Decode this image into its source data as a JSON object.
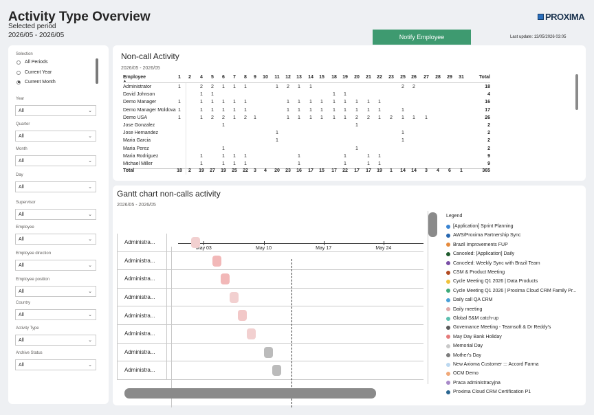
{
  "header": {
    "title": "Activity Type Overview",
    "subtitle": "Selected period",
    "range": "2026/05 - 2026/05",
    "notify_label": "Notify Employee",
    "last_update": "Last update: 13/05/2026 03:05",
    "logo_text": "PROXIMA"
  },
  "filters": {
    "selection_label": "Selection",
    "options": [
      "All Periods",
      "Current Year",
      "Current Month"
    ],
    "selected_option": "Current Month",
    "fields": [
      {
        "label": "Year",
        "value": "All"
      },
      {
        "label": "Quarter",
        "value": "All"
      },
      {
        "label": "Month",
        "value": "All"
      },
      {
        "label": "Day",
        "value": "All"
      },
      {
        "label": "Supervisor",
        "value": "All"
      },
      {
        "label": "Employee",
        "value": "All"
      },
      {
        "label": "Employee direction",
        "value": "All"
      },
      {
        "label": "Employee position",
        "value": "All"
      },
      {
        "label": "Country",
        "value": "All"
      },
      {
        "label": "Activity Type",
        "value": "All"
      },
      {
        "label": "Archive Status",
        "value": "All"
      }
    ]
  },
  "noncall": {
    "title": "Non-call Activity",
    "range": "2026/05 - 2026/05",
    "employee_header": "Employee",
    "total_header": "Total",
    "days": [
      "1",
      "2",
      "4",
      "5",
      "6",
      "7",
      "8",
      "9",
      "10",
      "11",
      "12",
      "13",
      "14",
      "15",
      "18",
      "19",
      "20",
      "21",
      "22",
      "23",
      "25",
      "26",
      "27",
      "28",
      "29",
      "31"
    ],
    "rows": [
      {
        "name": "Administrator",
        "cells": [
          "1",
          "",
          "2",
          "2",
          "1",
          "1",
          "1",
          "",
          "",
          "1",
          "2",
          "1",
          "1",
          "",
          "",
          "",
          "",
          "",
          "",
          "",
          "2",
          "2",
          "",
          "",
          "",
          ""
        ],
        "total": "18"
      },
      {
        "name": "David Johnson",
        "cells": [
          "",
          "",
          "1",
          "1",
          "",
          "",
          "",
          "",
          "",
          "",
          "",
          "",
          "",
          "",
          "1",
          "1",
          "",
          "",
          "",
          "",
          "",
          "",
          "",
          "",
          "",
          ""
        ],
        "total": "4"
      },
      {
        "name": "Demo Manager",
        "cells": [
          "1",
          "",
          "1",
          "1",
          "1",
          "1",
          "1",
          "",
          "",
          "",
          "1",
          "1",
          "1",
          "1",
          "1",
          "1",
          "1",
          "1",
          "1",
          "",
          "",
          "",
          "",
          "",
          "",
          ""
        ],
        "total": "16"
      },
      {
        "name": "Demo Manager Moldova",
        "cells": [
          "1",
          "",
          "1",
          "1",
          "1",
          "1",
          "1",
          "",
          "",
          "",
          "1",
          "1",
          "1",
          "1",
          "1",
          "1",
          "1",
          "1",
          "1",
          "",
          "1",
          "",
          "",
          "",
          "",
          ""
        ],
        "total": "17"
      },
      {
        "name": "Demo USA",
        "cells": [
          "1",
          "",
          "1",
          "2",
          "2",
          "1",
          "2",
          "1",
          "",
          "",
          "1",
          "1",
          "1",
          "1",
          "1",
          "1",
          "2",
          "2",
          "1",
          "2",
          "1",
          "1",
          "1",
          "",
          "",
          ""
        ],
        "total": "26"
      },
      {
        "name": "Jose Gonzalez",
        "cells": [
          "",
          "",
          "",
          "",
          "1",
          "",
          "",
          "",
          "",
          "",
          "",
          "",
          "",
          "",
          "",
          "",
          "1",
          "",
          "",
          "",
          "",
          "",
          "",
          "",
          "",
          ""
        ],
        "total": "2"
      },
      {
        "name": "Jose Hernandez",
        "cells": [
          "",
          "",
          "",
          "",
          "",
          "",
          "",
          "",
          "",
          "1",
          "",
          "",
          "",
          "",
          "",
          "",
          "",
          "",
          "",
          "",
          "1",
          "",
          "",
          "",
          "",
          ""
        ],
        "total": "2"
      },
      {
        "name": "Maria Garcia",
        "cells": [
          "",
          "",
          "",
          "",
          "",
          "",
          "",
          "",
          "",
          "1",
          "",
          "",
          "",
          "",
          "",
          "",
          "",
          "",
          "",
          "",
          "1",
          "",
          "",
          "",
          "",
          ""
        ],
        "total": "2"
      },
      {
        "name": "Maria Perez",
        "cells": [
          "",
          "",
          "",
          "",
          "1",
          "",
          "",
          "",
          "",
          "",
          "",
          "",
          "",
          "",
          "",
          "",
          "1",
          "",
          "",
          "",
          "",
          "",
          "",
          "",
          "",
          ""
        ],
        "total": "2"
      },
      {
        "name": "Maria Rodriguez",
        "cells": [
          "",
          "",
          "1",
          "",
          "1",
          "1",
          "1",
          "",
          "",
          "",
          "",
          "1",
          "",
          "",
          "",
          "1",
          "",
          "1",
          "1",
          "",
          "",
          "",
          "",
          "",
          "",
          ""
        ],
        "total": "9"
      },
      {
        "name": "Michael Miller",
        "cells": [
          "",
          "",
          "1",
          "",
          "1",
          "1",
          "1",
          "",
          "",
          "",
          "",
          "1",
          "",
          "",
          "",
          "1",
          "",
          "1",
          "1",
          "",
          "",
          "",
          "",
          "",
          "",
          ""
        ],
        "total": "9"
      }
    ],
    "total_row": {
      "name": "Total",
      "cells": [
        "18",
        "2",
        "19",
        "27",
        "19",
        "25",
        "22",
        "3",
        "4",
        "20",
        "23",
        "16",
        "17",
        "15",
        "17",
        "22",
        "17",
        "17",
        "19",
        "1",
        "14",
        "14",
        "3",
        "4",
        "6",
        "1"
      ],
      "total": "365"
    }
  },
  "gantt": {
    "title": "Gantt chart non-calls activity",
    "range": "2026/05 - 2026/05",
    "ticks": [
      "May 03",
      "May 10",
      "May 17",
      "May 24"
    ],
    "rows": [
      {
        "label": "Administra...",
        "start_day": 1.5,
        "color": "#f2d0d0"
      },
      {
        "label": "Administra...",
        "start_day": 4.0,
        "color": "#f2b8b8"
      },
      {
        "label": "Administra...",
        "start_day": 5.0,
        "color": "#f2b8b8"
      },
      {
        "label": "Administra...",
        "start_day": 6.0,
        "color": "#f2d0d0"
      },
      {
        "label": "Administra...",
        "start_day": 7.0,
        "color": "#f2c8c8"
      },
      {
        "label": "Administra...",
        "start_day": 8.0,
        "color": "#f2d0d0"
      },
      {
        "label": "Administra...",
        "start_day": 10.0,
        "color": "#bbbbbb"
      },
      {
        "label": "Administra...",
        "start_day": 11.0,
        "color": "#bbbbbb"
      }
    ],
    "legend_title": "Legend",
    "legend": [
      {
        "name": "[Application] Sprint Planning",
        "color": "#3a84d1"
      },
      {
        "name": "AWS/Proxima Partnership Sync",
        "color": "#2767b0"
      },
      {
        "name": "Brazil Improvements FUP",
        "color": "#e58a3c"
      },
      {
        "name": "Canceled: [Application] Daily",
        "color": "#1f5b2e"
      },
      {
        "name": "Canceled: Weekly Sync with Brazil Team",
        "color": "#7a4fa6"
      },
      {
        "name": "CSM & Product Meeting",
        "color": "#b24b22"
      },
      {
        "name": "Cycle Meeting Q1 2026 | Data Products",
        "color": "#f0c23c"
      },
      {
        "name": "Cycle Meeting Q1 2026 | Proxima Cloud CRM Family Pr...",
        "color": "#3daa7a"
      },
      {
        "name": "Daily call QA CRM",
        "color": "#4aa0d8"
      },
      {
        "name": "Daily meeting",
        "color": "#e0a8a8"
      },
      {
        "name": "Global S&M catch-up",
        "color": "#5cbfb0"
      },
      {
        "name": "Governance Meeting - Teamsoft & Dr Reddy's",
        "color": "#5a5a5a"
      },
      {
        "name": "May Day Bank Holiday",
        "color": "#e57a7a"
      },
      {
        "name": "Memorial Day",
        "color": "#c9c9c9"
      },
      {
        "name": "Mother's Day",
        "color": "#7c7c7c"
      },
      {
        "name": "New Axioma Customer ::: Accord Farma",
        "color": "#bcd8f0"
      },
      {
        "name": "OCM Demo",
        "color": "#f0a878"
      },
      {
        "name": "Praca administracyjna",
        "color": "#a88ac8"
      },
      {
        "name": "Proxima Cloud CRM Certification P1",
        "color": "#2a6690"
      }
    ]
  }
}
